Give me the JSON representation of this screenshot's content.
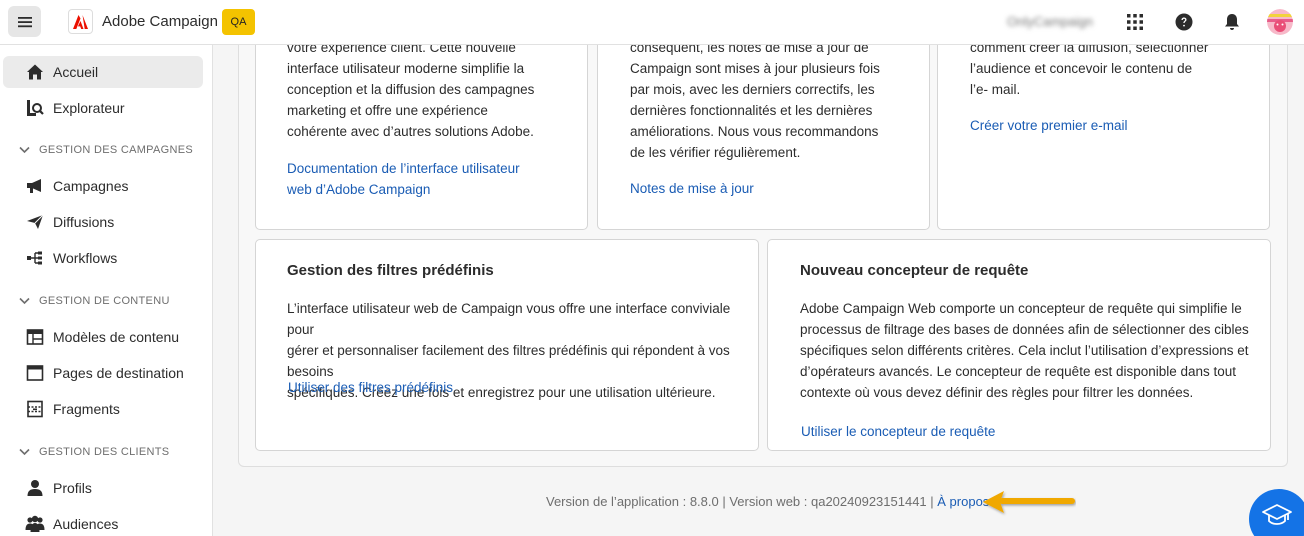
{
  "header": {
    "app_name": "Adobe Campaign",
    "env_badge": "QA",
    "org_name": "OnlyCampaign",
    "icons": [
      "menu-icon",
      "apps-grid-icon",
      "help-icon",
      "bell-icon",
      "avatar"
    ]
  },
  "sidebar": {
    "home": "Accueil",
    "explorer": "Explorateur",
    "sections": [
      {
        "title": "GESTION DES CAMPAGNES",
        "items": [
          "Campagnes",
          "Diffusions",
          "Workflows"
        ]
      },
      {
        "title": "GESTION DE CONTENU",
        "items": [
          "Modèles de contenu",
          "Pages de destination",
          "Fragments"
        ]
      },
      {
        "title": "GESTION DES CLIENTS",
        "items": [
          "Profils",
          "Audiences"
        ]
      }
    ]
  },
  "cards_top": [
    {
      "text": [
        "votre expérience client. Cette nouvelle",
        "interface utilisateur moderne simplifie la",
        "conception et la diffusion des campagnes",
        "marketing et offre une expérience",
        "cohérente avec d’autres solutions Adobe."
      ],
      "link": [
        "Documentation de l’interface utilisateur",
        "web d’Adobe Campaign"
      ]
    },
    {
      "text": [
        "conséquent, les notes de mise à jour de",
        "Campaign sont mises à jour plusieurs fois",
        "par mois, avec les derniers correctifs, les",
        "dernières fonctionnalités et les dernières",
        "améliorations. Nous vous recommandons",
        "de les vérifier régulièrement."
      ],
      "link": [
        "Notes de mise à jour"
      ]
    },
    {
      "text": [
        "comment créer la diffusion, sélectionner",
        "l’audience et concevoir le contenu de",
        "l’e- mail."
      ],
      "link": [
        "Créer votre premier e-mail"
      ]
    }
  ],
  "cards_bottom": [
    {
      "title": "Gestion des filtres prédéfinis",
      "text": [
        "L’interface utilisateur web de Campaign vous offre une interface conviviale pour",
        "gérer et personnaliser facilement des filtres prédéfinis qui répondent à vos besoins",
        "spécifiques. Créez une fois et enregistrez pour une utilisation ultérieure."
      ],
      "link": "Utiliser des filtres prédéfinis"
    },
    {
      "title": "Nouveau concepteur de requête",
      "text": [
        "Adobe Campaign Web comporte un concepteur de requête qui simplifie le",
        "processus de filtrage des bases de données afin de sélectionner des cibles",
        "spécifiques selon différents critères. Cela inclut l’utilisation d’expressions et",
        "d’opérateurs avancés. Le concepteur de requête est disponible dans tout",
        "contexte où vous devez définir des règles pour filtrer les données."
      ],
      "link": "Utiliser le concepteur de requête"
    }
  ],
  "footer": {
    "version_text": "Version de l’application : 8.8.0 | Version web : qa20240923151441 | ",
    "about_link": "À propos"
  },
  "colors": {
    "link": "#1a5cb4",
    "badge": "#f4c300",
    "adobe_red": "#eb1000",
    "annotation_arrow": "#f0a800",
    "help_button": "#1473e6"
  }
}
